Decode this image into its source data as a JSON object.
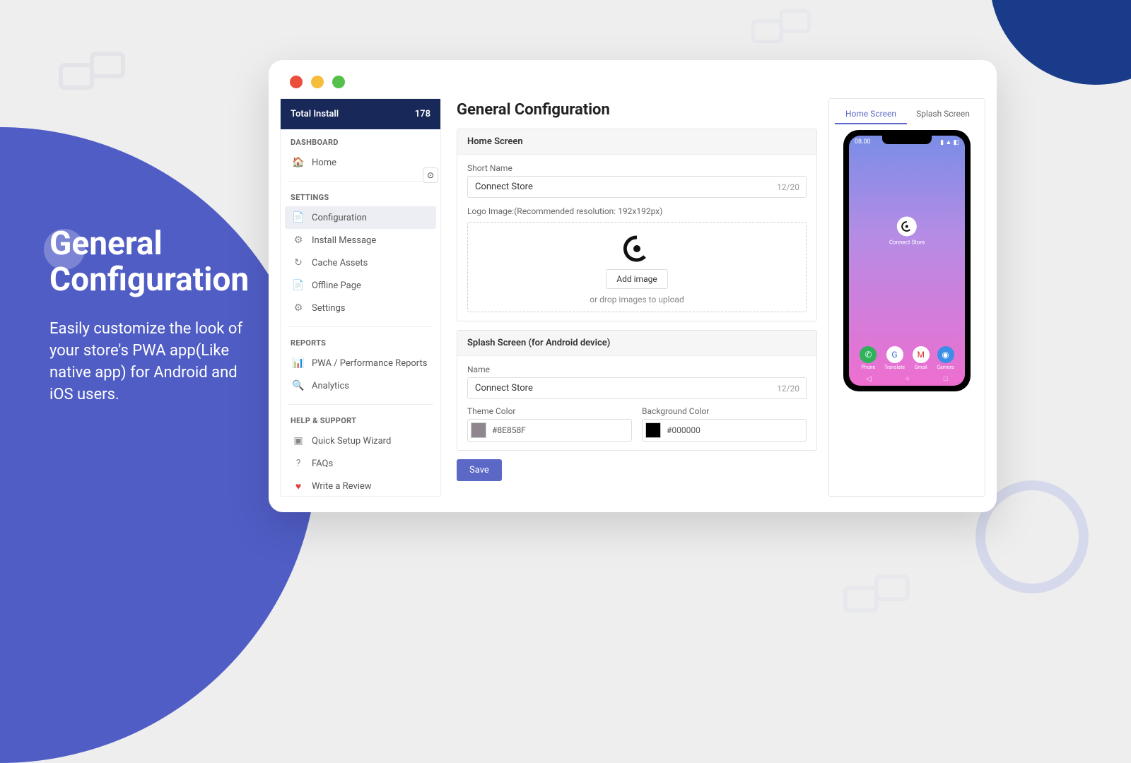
{
  "left": {
    "title1": "General",
    "title2": "Configuration",
    "desc": "Easily customize the look of your store's PWA app(Like native app) for Android and iOS users."
  },
  "sidebar": {
    "install_label": "Total Install",
    "install_count": "178",
    "sections": {
      "dashboard": "DASHBOARD",
      "settings": "SETTINGS",
      "reports": "REPORTS",
      "help": "HELP & SUPPORT"
    },
    "items": {
      "home": "Home",
      "configuration": "Configuration",
      "install_message": "Install Message",
      "cache_assets": "Cache Assets",
      "offline_page": "Offline Page",
      "settings": "Settings",
      "perf": "PWA / Performance Reports",
      "analytics": "Analytics",
      "wizard": "Quick Setup Wizard",
      "faqs": "FAQs",
      "review": "Write a Review"
    }
  },
  "page": {
    "title": "General Configuration",
    "save": "Save",
    "home_screen": {
      "header": "Home Screen",
      "short_name_label": "Short Name",
      "short_name_value": "Connect Store",
      "short_name_counter": "12/20",
      "logo_label": "Logo Image:(Recommended resolution: 192x192px)",
      "add_image": "Add image",
      "drop_text": "or drop images to upload"
    },
    "splash": {
      "header": "Splash Screen (for Android device)",
      "name_label": "Name",
      "name_value": "Connect Store",
      "name_counter": "12/20",
      "theme_label": "Theme Color",
      "theme_value": "#8E858F",
      "bg_label": "Background Color",
      "bg_value": "#000000"
    }
  },
  "preview": {
    "tab_home": "Home Screen",
    "tab_splash": "Splash Screen",
    "time": "08.00",
    "app_name": "Connect Store",
    "dock": {
      "phone": "Phone",
      "translate": "Translate",
      "gmail": "Gmail",
      "camera": "Camera"
    }
  }
}
